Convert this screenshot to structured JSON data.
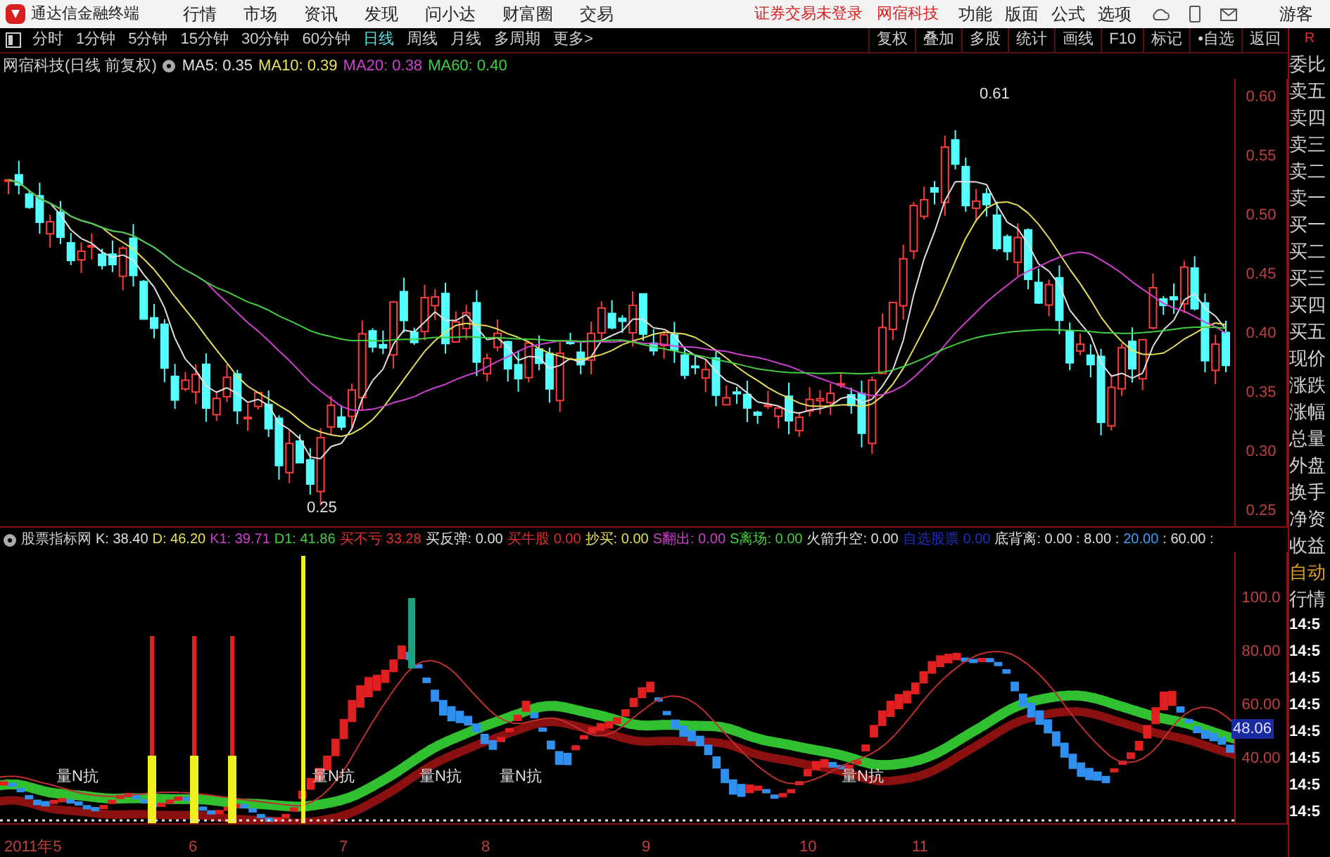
{
  "menu_bar": {
    "app_title": "通达信金融终端",
    "menus": [
      "行情",
      "市场",
      "资讯",
      "发现",
      "问小达",
      "财富圈",
      "交易"
    ],
    "alerts": [
      "证券交易未登录",
      "网宿科技"
    ],
    "right_menus": [
      "功能",
      "版面",
      "公式",
      "选项"
    ],
    "user": "游客"
  },
  "toolbar": {
    "periods": [
      {
        "label": "分时",
        "selected": false
      },
      {
        "label": "1分钟",
        "selected": false
      },
      {
        "label": "5分钟",
        "selected": false
      },
      {
        "label": "15分钟",
        "selected": false
      },
      {
        "label": "30分钟",
        "selected": false
      },
      {
        "label": "60分钟",
        "selected": false
      },
      {
        "label": "日线",
        "selected": true
      },
      {
        "label": "周线",
        "selected": false
      },
      {
        "label": "月线",
        "selected": false
      },
      {
        "label": "多周期",
        "selected": false
      },
      {
        "label": "更多>",
        "selected": false
      }
    ],
    "buttons": [
      "复权",
      "叠加",
      "多股",
      "统计",
      "画线",
      "F10",
      "标记",
      "•自选",
      "返回"
    ]
  },
  "chart_header": {
    "title": "网宿科技(日线 前复权)",
    "indicators": [
      {
        "label": "MA5: 0.35",
        "color": "#e0e0e0"
      },
      {
        "label": "MA10: 0.39",
        "color": "#e8e05a"
      },
      {
        "label": "MA20: 0.38",
        "color": "#d040d0"
      },
      {
        "label": "MA60: 0.40",
        "color": "#40d040"
      }
    ]
  },
  "price_chart": {
    "high_label": "0.61",
    "low_label": "0.25",
    "axis_ticks": [
      "0.60",
      "0.55",
      "0.50",
      "0.45",
      "0.40",
      "0.35",
      "0.30",
      "0.25"
    ]
  },
  "indicator_header": {
    "title": "股票指标网",
    "items": [
      {
        "label": "K: 38.40",
        "color": "#e0e0e0"
      },
      {
        "label": "D: 46.20",
        "color": "#e8e05a"
      },
      {
        "label": "K1: 39.71",
        "color": "#d040d0"
      },
      {
        "label": "D1: 41.86",
        "color": "#40d040"
      },
      {
        "label": "买不亏",
        "color": "#e03030"
      },
      {
        "label": "33.28",
        "color": "#e03030"
      },
      {
        "label": "买反弹: 0.00",
        "color": "#e0e0e0"
      },
      {
        "label": "买牛股",
        "color": "#e03030"
      },
      {
        "label": "0.00",
        "color": "#e03030"
      },
      {
        "label": "抄买: 0.00",
        "color": "#e8e05a"
      },
      {
        "label": "S翻出: 0.00",
        "color": "#d040d0"
      },
      {
        "label": "S离场: 0.00",
        "color": "#40d040"
      },
      {
        "label": "火箭升空: 0.00",
        "color": "#e0e0e0"
      },
      {
        "label": "自选股票",
        "color": "#2030c0"
      },
      {
        "label": "0.00",
        "color": "#2030c0"
      },
      {
        "label": "底背离: 0.00 : 8.00 :",
        "color": "#e0e0e0"
      },
      {
        "label": "20.00",
        "color": "#40a0ff"
      },
      {
        "label": ": 60.00 :",
        "color": "#e0e0e0"
      }
    ]
  },
  "indicator_chart": {
    "labels": [
      "量N抗",
      "量N抗",
      "量N抗",
      "量N抗",
      "量N抗"
    ],
    "axis_ticks": [
      "100.0",
      "80.00",
      "60.00",
      "40.00"
    ],
    "current_value": "48.06"
  },
  "date_axis": [
    "2011年5",
    "6",
    "7",
    "8",
    "9",
    "10",
    "11"
  ],
  "side_panel": {
    "header": "R",
    "fields": [
      "委比",
      "卖五",
      "卖四",
      "卖三",
      "卖二",
      "卖一",
      "买一",
      "买二",
      "买三",
      "买四",
      "买五",
      "现价",
      "涨跌",
      "涨幅",
      "总量",
      "外盘",
      "换手",
      "净资",
      "收益"
    ],
    "mode": [
      "自动",
      "行情"
    ],
    "times": [
      "14:5",
      "14:5",
      "14:5",
      "14:5",
      "14:5",
      "14:5",
      "14:5",
      "14:5"
    ]
  }
}
